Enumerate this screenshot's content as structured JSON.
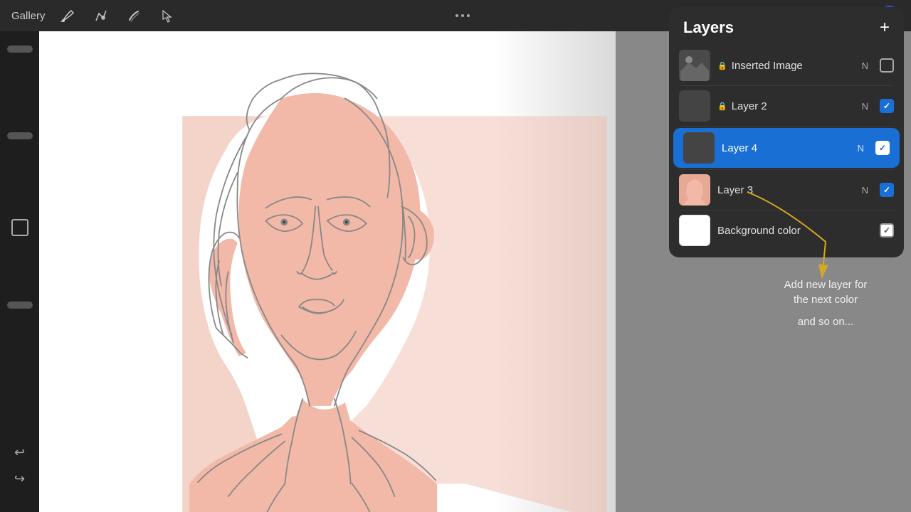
{
  "toolbar": {
    "gallery_label": "Gallery",
    "more_options": "...",
    "tool_icons": [
      "✏️",
      "⟨⟩",
      "S",
      "↗"
    ]
  },
  "layers_panel": {
    "title": "Layers",
    "add_button": "+",
    "layers": [
      {
        "id": "inserted-image",
        "name": "Inserted Image",
        "mode": "N",
        "visible": false,
        "locked": true,
        "thumb_type": "img"
      },
      {
        "id": "layer-2",
        "name": "Layer 2",
        "mode": "N",
        "visible": true,
        "locked": true,
        "thumb_type": "dark"
      },
      {
        "id": "layer-4",
        "name": "Layer 4",
        "mode": "N",
        "visible": true,
        "locked": false,
        "thumb_type": "dark",
        "active": true
      },
      {
        "id": "layer-3",
        "name": "Layer 3",
        "mode": "N",
        "visible": true,
        "locked": false,
        "thumb_type": "portrait"
      },
      {
        "id": "background-color",
        "name": "Background color",
        "mode": "",
        "visible": true,
        "locked": false,
        "thumb_type": "white"
      }
    ]
  },
  "annotation": {
    "line1": "Add new layer for",
    "line2": "the next color",
    "line3": "and so on..."
  }
}
